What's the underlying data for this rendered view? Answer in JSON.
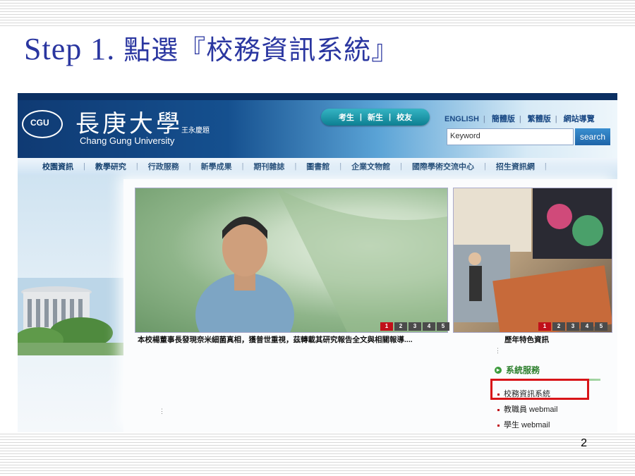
{
  "slide": {
    "title_prefix": "Step 1.",
    "title_cjk": "點選『校務資訊系統』",
    "page_number": "2"
  },
  "site": {
    "logo_cn": "長庚大學",
    "logo_sign": "王永慶題",
    "logo_en": "Chang Gung University",
    "logo_mark": "CGU",
    "audience_links": [
      "考生",
      "新生",
      "校友"
    ],
    "top_links": [
      "ENGLISH",
      "簡體版",
      "繁體版",
      "網站導覽"
    ],
    "search": {
      "placeholder": "Keyword",
      "button": "search"
    },
    "nav": [
      "校園資訊",
      "教學研究",
      "行政服務",
      "新學成果",
      "期刊雜誌",
      "圖書館",
      "企業文物館",
      "國際學術交流中心",
      "招生資訊網"
    ],
    "feature": {
      "caption": "本校楊董事長發現奈米細菌真相，獲普世重視，茲轉載其研究報告全文與相關報導....",
      "pages": [
        "1",
        "2",
        "3",
        "4",
        "5"
      ],
      "active_page": "1"
    },
    "feature2": {
      "caption": "歷年特色資訊",
      "pages": [
        "1",
        "2",
        "3",
        "4",
        "5"
      ],
      "active_page": "1"
    },
    "services": {
      "title": "系統服務",
      "items": [
        "校務資訊系統",
        "教職員 webmail",
        "學生 webmail"
      ]
    }
  },
  "colors": {
    "title": "#2a36a0",
    "highlight": "#d81418",
    "accent": "#3c9b3c"
  }
}
